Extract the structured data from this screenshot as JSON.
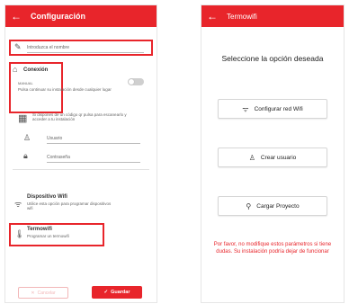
{
  "left": {
    "title": "Configuración",
    "name_placeholder": "Introduzca el nombre",
    "conexion": {
      "heading": "Conexión",
      "wps_label": "MANUAL",
      "wps_hint": "Pulsa continuar su instalación desde cualquier lugar",
      "qr_hint": "Si dispones de un código qr pulsa para escanearlo y acceder a tu instalación",
      "user_placeholder": "Usuario",
      "pass_placeholder": "Contraseña"
    },
    "wifi": {
      "title": "Dispositivo Wifi",
      "desc": "Utilice esta opción para programar dispositivos wifi"
    },
    "termowifi": {
      "title": "Termowifi",
      "desc": "Programar un termowifi"
    },
    "cancel_label": "Cancelar",
    "save_label": "Guardar"
  },
  "right": {
    "title": "Termowifi",
    "heading": "Seleccione la opción deseada",
    "options": [
      {
        "label": "Configurar red Wifi",
        "icon": "wifi-icon"
      },
      {
        "label": "Crear usuario",
        "icon": "user-icon"
      },
      {
        "label": "Cargar Proyecto",
        "icon": "search-icon"
      }
    ],
    "warning": "Por favor, no modifique estos parámetros si tiene dudas. Su instalación podría dejar de funcionar"
  },
  "colors": {
    "accent": "#e8252b"
  }
}
